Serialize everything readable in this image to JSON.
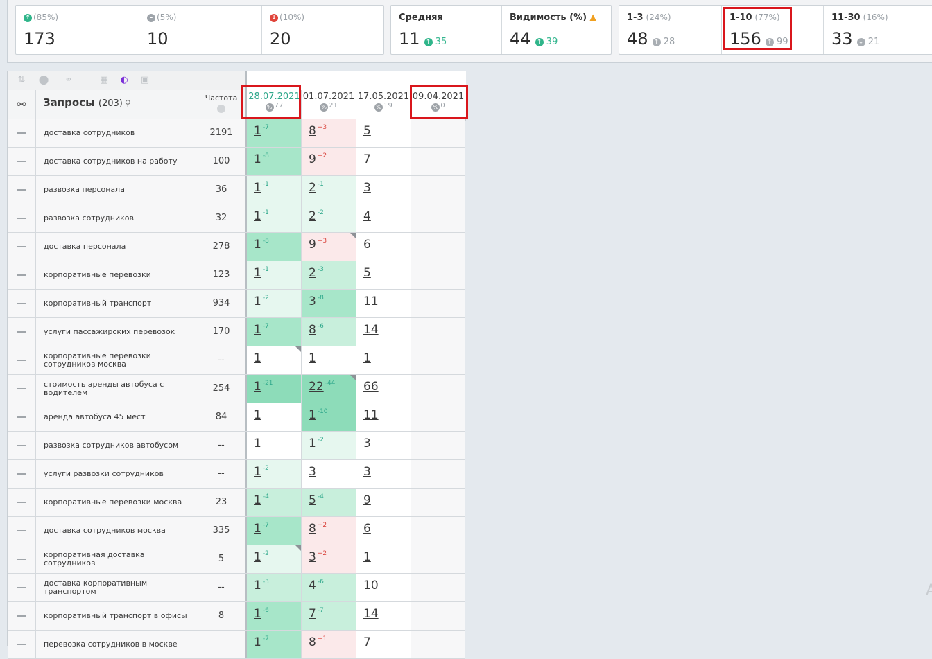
{
  "stats": {
    "card1": [
      {
        "icon": "up-arrow-icon",
        "pct": "(85%)",
        "value": "173"
      },
      {
        "icon": "equal-icon",
        "pct": "(5%)",
        "value": "10"
      },
      {
        "icon": "down-arrow-icon",
        "pct": "(10%)",
        "value": "20"
      }
    ],
    "avg": {
      "label": "Средняя",
      "value": "11",
      "delta": "35"
    },
    "visibility": {
      "label": "Видимость (%)",
      "value": "44",
      "delta": "39"
    },
    "ranges": [
      {
        "label": "1-3",
        "pct": "(24%)",
        "value": "48",
        "delta": "28",
        "dir": "up"
      },
      {
        "label": "1-10",
        "pct": "(77%)",
        "value": "156",
        "delta": "99",
        "dir": "up"
      },
      {
        "label": "11-30",
        "pct": "(16%)",
        "value": "33",
        "delta": "21",
        "dir": "down"
      }
    ]
  },
  "colors": {
    "accent": "#2fa88b",
    "negative": "#d9413a",
    "highlight": "#d9161c",
    "active_tool": "#7b2fd8"
  },
  "table": {
    "queries_title": "Запросы",
    "queries_count": "(203)",
    "freq_header": "Частота",
    "dates": [
      {
        "date": "28.07.2021",
        "count": "77"
      },
      {
        "date": "01.07.2021",
        "count": "21"
      },
      {
        "date": "17.05.2021",
        "count": "19"
      },
      {
        "date": "09.04.2021",
        "count": "0"
      }
    ],
    "rows": [
      {
        "q": "доставка сотрудников",
        "f": "2191",
        "c": [
          {
            "v": "1",
            "d": "-7",
            "dc": "g",
            "bg": "g1"
          },
          {
            "v": "8",
            "d": "+3",
            "dc": "r",
            "bg": "r"
          },
          {
            "v": "5",
            "d": "",
            "bg": "w"
          }
        ]
      },
      {
        "q": "доставка сотрудников на работу",
        "f": "100",
        "c": [
          {
            "v": "1",
            "d": "-8",
            "dc": "g",
            "bg": "g1"
          },
          {
            "v": "9",
            "d": "+2",
            "dc": "r",
            "bg": "r"
          },
          {
            "v": "7",
            "d": "",
            "bg": "w"
          }
        ]
      },
      {
        "q": "развозка персонала",
        "f": "36",
        "c": [
          {
            "v": "1",
            "d": "-1",
            "dc": "g",
            "bg": "g3"
          },
          {
            "v": "2",
            "d": "-1",
            "dc": "g",
            "bg": "g3"
          },
          {
            "v": "3",
            "d": "",
            "bg": "w"
          }
        ]
      },
      {
        "q": "развозка сотрудников",
        "f": "32",
        "c": [
          {
            "v": "1",
            "d": "-1",
            "dc": "g",
            "bg": "g3"
          },
          {
            "v": "2",
            "d": "-2",
            "dc": "g",
            "bg": "g3"
          },
          {
            "v": "4",
            "d": "",
            "bg": "w"
          }
        ]
      },
      {
        "q": "доставка персонала",
        "f": "278",
        "c": [
          {
            "v": "1",
            "d": "-8",
            "dc": "g",
            "bg": "g1"
          },
          {
            "v": "9",
            "d": "+3",
            "dc": "r",
            "bg": "r",
            "corner": true
          },
          {
            "v": "6",
            "d": "",
            "bg": "w"
          }
        ]
      },
      {
        "q": "корпоративные перевозки",
        "f": "123",
        "c": [
          {
            "v": "1",
            "d": "-1",
            "dc": "g",
            "bg": "g3"
          },
          {
            "v": "2",
            "d": "-3",
            "dc": "g",
            "bg": "g2"
          },
          {
            "v": "5",
            "d": "",
            "bg": "w"
          }
        ]
      },
      {
        "q": "корпоративный транспорт",
        "f": "934",
        "c": [
          {
            "v": "1",
            "d": "-2",
            "dc": "g",
            "bg": "g3"
          },
          {
            "v": "3",
            "d": "-8",
            "dc": "g",
            "bg": "g1"
          },
          {
            "v": "11",
            "d": "",
            "bg": "w"
          }
        ]
      },
      {
        "q": "услуги пассажирских перевозок",
        "f": "170",
        "c": [
          {
            "v": "1",
            "d": "-7",
            "dc": "g",
            "bg": "g1"
          },
          {
            "v": "8",
            "d": "-6",
            "dc": "g",
            "bg": "g2"
          },
          {
            "v": "14",
            "d": "",
            "bg": "w"
          }
        ]
      },
      {
        "q": "корпоративные перевозки сотрудников москва",
        "f": "--",
        "c": [
          {
            "v": "1",
            "d": "",
            "bg": "w",
            "corner": true
          },
          {
            "v": "1",
            "d": "",
            "bg": "w"
          },
          {
            "v": "1",
            "d": "",
            "bg": "w"
          }
        ]
      },
      {
        "q": "стоимость аренды автобуса с водителем",
        "f": "254",
        "c": [
          {
            "v": "1",
            "d": "-21",
            "dc": "g",
            "bg": "g4"
          },
          {
            "v": "22",
            "d": "-44",
            "dc": "g",
            "bg": "g4",
            "corner": true
          },
          {
            "v": "66",
            "d": "",
            "bg": "w"
          }
        ]
      },
      {
        "q": "аренда автобуса 45 мест",
        "f": "84",
        "c": [
          {
            "v": "1",
            "d": "",
            "bg": "w"
          },
          {
            "v": "1",
            "d": "-10",
            "dc": "g",
            "bg": "g4"
          },
          {
            "v": "11",
            "d": "",
            "bg": "w"
          }
        ]
      },
      {
        "q": "развозка сотрудников автобусом",
        "f": "--",
        "c": [
          {
            "v": "1",
            "d": "",
            "bg": "w"
          },
          {
            "v": "1",
            "d": "-2",
            "dc": "g",
            "bg": "g3"
          },
          {
            "v": "3",
            "d": "",
            "bg": "w"
          }
        ]
      },
      {
        "q": "услуги развозки сотрудников",
        "f": "--",
        "c": [
          {
            "v": "1",
            "d": "-2",
            "dc": "g",
            "bg": "g3"
          },
          {
            "v": "3",
            "d": "",
            "bg": "w"
          },
          {
            "v": "3",
            "d": "",
            "bg": "w"
          }
        ]
      },
      {
        "q": "корпоративные перевозки москва",
        "f": "23",
        "c": [
          {
            "v": "1",
            "d": "-4",
            "dc": "g",
            "bg": "g2"
          },
          {
            "v": "5",
            "d": "-4",
            "dc": "g",
            "bg": "g2"
          },
          {
            "v": "9",
            "d": "",
            "bg": "w"
          }
        ]
      },
      {
        "q": "доставка сотрудников москва",
        "f": "335",
        "c": [
          {
            "v": "1",
            "d": "-7",
            "dc": "g",
            "bg": "g1"
          },
          {
            "v": "8",
            "d": "+2",
            "dc": "r",
            "bg": "r"
          },
          {
            "v": "6",
            "d": "",
            "bg": "w"
          }
        ]
      },
      {
        "q": "корпоративная доставка сотрудников",
        "f": "5",
        "c": [
          {
            "v": "1",
            "d": "-2",
            "dc": "g",
            "bg": "g3",
            "corner": true
          },
          {
            "v": "3",
            "d": "+2",
            "dc": "r",
            "bg": "r"
          },
          {
            "v": "1",
            "d": "",
            "bg": "w"
          }
        ]
      },
      {
        "q": "доставка корпоративным транспортом",
        "f": "--",
        "c": [
          {
            "v": "1",
            "d": "-3",
            "dc": "g",
            "bg": "g2"
          },
          {
            "v": "4",
            "d": "-6",
            "dc": "g",
            "bg": "g2"
          },
          {
            "v": "10",
            "d": "",
            "bg": "w"
          }
        ]
      },
      {
        "q": "корпоративный транспорт в офисы",
        "f": "8",
        "c": [
          {
            "v": "1",
            "d": "-6",
            "dc": "g",
            "bg": "g1"
          },
          {
            "v": "7",
            "d": "-7",
            "dc": "g",
            "bg": "g2"
          },
          {
            "v": "14",
            "d": "",
            "bg": "w"
          }
        ]
      },
      {
        "q": "перевозка сотрудников в москве",
        "f": "",
        "c": [
          {
            "v": "1",
            "d": "-7",
            "dc": "g",
            "bg": "g1"
          },
          {
            "v": "8",
            "d": "+1",
            "dc": "r",
            "bg": "r"
          },
          {
            "v": "7",
            "d": "",
            "bg": "w"
          }
        ]
      }
    ]
  }
}
